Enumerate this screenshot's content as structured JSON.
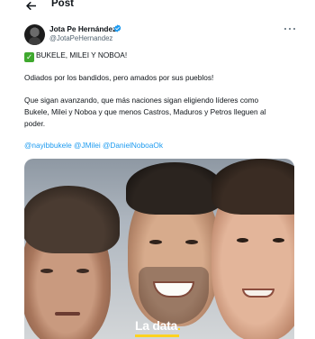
{
  "header": {
    "title": "Post",
    "back_icon": "arrow-left-icon"
  },
  "author": {
    "name": "Jota Pe Hernández",
    "handle": "@JotaPeHernandez",
    "verified": true,
    "verified_color": "#1d9bf0"
  },
  "post": {
    "line1": "BUKELE, MILEI Y NOBOA!",
    "line2": "Odiados por los bandidos, pero amados por sus pueblos!",
    "line3": "Que sigan avanzando, que más naciones sigan eligiendo líderes como",
    "line4": "Bukele, Milei y Noboa y que menos Castros, Maduros y Petros lleguen al",
    "line5": "poder.",
    "mentions": [
      "@nayibbukele",
      "@JMilei",
      "@DanielNoboaOk"
    ]
  },
  "media": {
    "watermark_pre": "La",
    "watermark_main": "data",
    "watermark_dot": "."
  },
  "colors": {
    "link": "#1d9bf0",
    "text": "#0f1419",
    "secondary": "#536471",
    "check": "#3fa82e",
    "watermark_accent": "#ffd21f"
  }
}
